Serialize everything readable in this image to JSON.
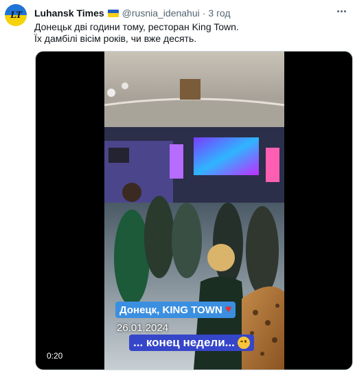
{
  "tweet": {
    "author_name": "Luhansk Times",
    "avatar_text": "LT",
    "flag_icon": "ukraine-flag",
    "handle": "@rusnia_idenahui",
    "separator": "·",
    "time": "3 год",
    "lines": [
      "Донецьк дві години тому, ресторан King Town.",
      "Їх дамбілі вісім років, чи вже десять."
    ]
  },
  "video": {
    "duration": "0:20",
    "caption_location": "Донецк, KING TOWN",
    "caption_date": "26.01.2024",
    "caption_bottom": "... конец недели...",
    "colors": {
      "caption_blue": "#3b8fe0",
      "caption_indigo": "#3646c9",
      "heart": "#e8322f"
    }
  }
}
